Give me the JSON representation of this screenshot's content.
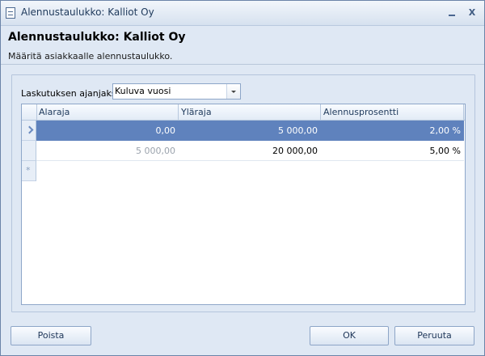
{
  "window": {
    "title": "Alennustaulukko: Kalliot Oy",
    "minimize_label": "",
    "close_label": "X"
  },
  "header": {
    "title": "Alennustaulukko: Kalliot Oy",
    "subtitle": "Määritä asiakkaalle alennustaulukko."
  },
  "filter": {
    "label": "Laskutuksen ajanjakso",
    "selected": "Kuluva vuosi"
  },
  "grid": {
    "columns": [
      "Alaraja",
      "Yläraja",
      "Alennusprosentti"
    ],
    "rows": [
      [
        "0,00",
        "5 000,00",
        "2,00 %"
      ],
      [
        "5 000,00",
        "20 000,00",
        "5,00 %"
      ]
    ],
    "new_row_symbol": "*"
  },
  "footer": {
    "delete_label": "Poista",
    "ok_label": "OK",
    "cancel_label": "Peruuta"
  },
  "colors": {
    "accent": "#5f82bd",
    "window_bg": "#dfe8f4"
  }
}
